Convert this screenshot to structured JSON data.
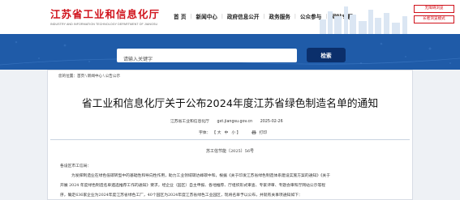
{
  "header": {
    "logo_zh": "江苏省工业和信息化厅",
    "logo_en": "INDUSTRY AND INFORMATION TECHNOLOGY DEPARTMENT OF JIANGSU",
    "nav": [
      "首 页",
      "新闻中心",
      "政府信息公开",
      "政务服务",
      "公众参与",
      "网站专题"
    ],
    "side_links": [
      "无障碍浏览",
      "长者浏览模式"
    ]
  },
  "search": {
    "placeholder": "请输入关键字",
    "button_label": "检索"
  },
  "breadcrumb": {
    "prefix": "您的位置：",
    "items": [
      "首页",
      "新闻中心",
      "公告公示"
    ]
  },
  "article": {
    "title": "省工业和信息化厅关于公布2024年度江苏省绿色制造名单的通知",
    "meta_source": "江苏省工业和信息化厅",
    "meta_site": "gxt.jiangsu.gov.cn",
    "meta_date": "2025-02-26",
    "font_size_label": "字体：",
    "font_large": "【 大",
    "font_medium": "中",
    "font_small": "小 】",
    "print_label": "打印",
    "doc_number": "苏工信节能〔2025〕56号",
    "salutation": "各设区市工信局：",
    "paragraphs": [
      "为发挥制造业在绿色低碳转型中的基础性和导向性作用，助力工业领域碳达峰碳中和，根据《关于印发江苏省绿色制造体系建设实施方案的通知》《关于",
      "开展 2024 年度绿色制造名单遴选推荐工作的通知》要求，经企业（园区）自主申报、各地推荐、厅组织形式审查、专家评审、专题会审和厅网站公示等程",
      "序，确定636家企业为2024年度江苏省绿色工厂，40个园区为2024年度江苏省绿色工业园区，现将名单予以公布，并就有关事项通知如下："
    ]
  },
  "colors": {
    "brand_red": "#d0121b",
    "band_blue": "#1f5ba8",
    "button_navy": "#0b2f6b"
  }
}
